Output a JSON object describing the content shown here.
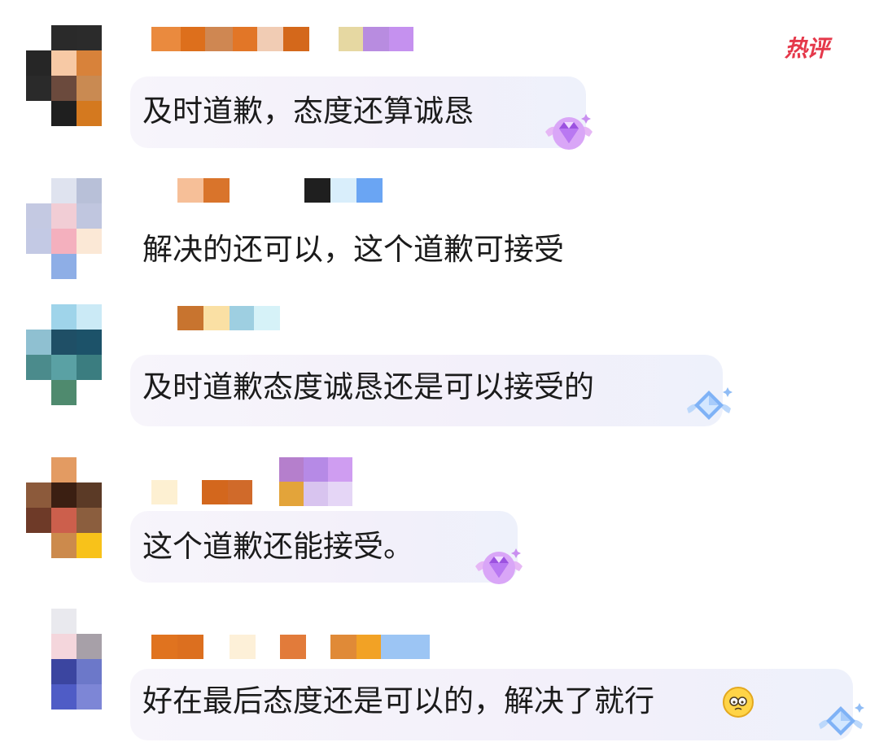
{
  "header": {
    "hot_badge": "热评"
  },
  "comments": [
    {
      "text": "及时道歉，态度还算诚恳",
      "medal": "purple-gem-medal-icon"
    },
    {
      "text": "解决的还可以，这个道歉可接受",
      "medal": ""
    },
    {
      "text": "及时道歉态度诚恳还是可以接受的",
      "medal": "blue-gem-medal-icon"
    },
    {
      "text": "这个道歉还能接受。",
      "medal": "purple-gem-medal-icon"
    },
    {
      "text": "好在最后态度还是可以的，解决了就行",
      "medal": "blue-gem-medal-icon",
      "trailing_emoji": "nervous-sweat-emoji"
    }
  ],
  "colors": {
    "hot_badge": "#e5384a",
    "bubble": "#f3f0fa",
    "text": "#1b1b1b"
  }
}
